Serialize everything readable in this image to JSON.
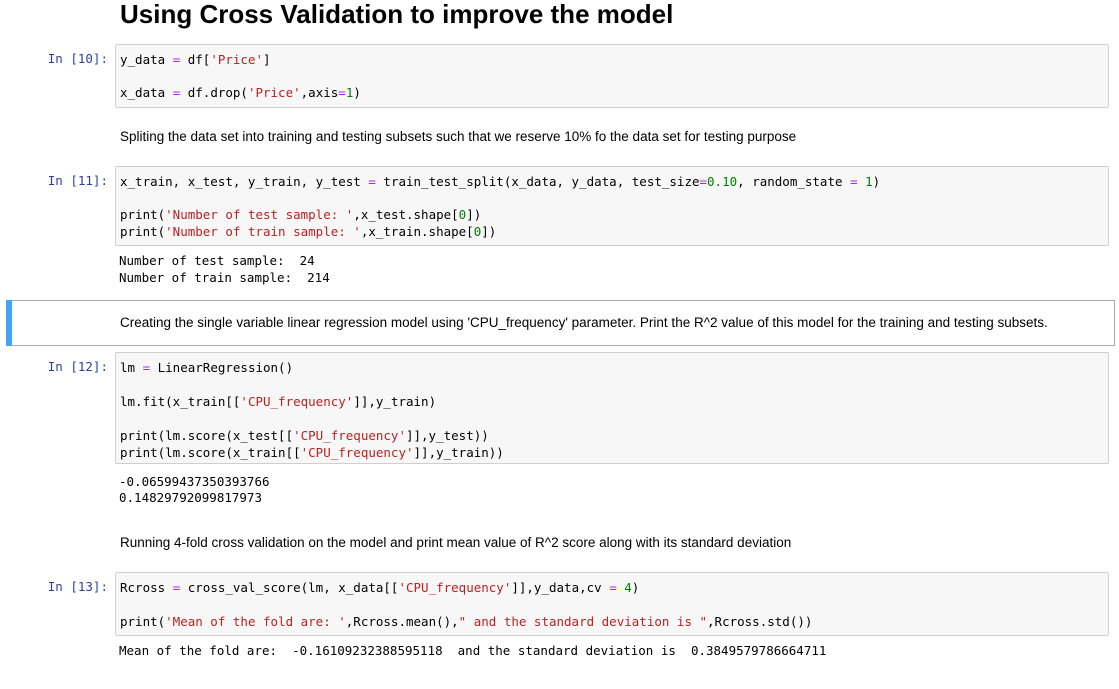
{
  "heading": "Using Cross Validation to improve the model",
  "cells": {
    "c10": {
      "prompt": "In [10]:",
      "lines": [
        {
          "a": "y_data ",
          "op": "=",
          "b": " df[",
          "s": "'Price'",
          "c": "]"
        },
        {
          "a": "x_data ",
          "op": "=",
          "b": " df.drop(",
          "s": "'Price'",
          "c": ",axis",
          "op2": "=",
          "n": "1",
          "d": ")"
        }
      ]
    },
    "md1": "Spliting the data set into training and testing subsets such that we reserve 10% fo the data set for testing purpose",
    "c11": {
      "prompt": "In [11]:",
      "l1a": "x_train, x_test, y_train, y_test ",
      "l1op": "=",
      "l1b": " train_test_split(x_data, y_data, test_size",
      "l1op2": "=",
      "l1n": "0.10",
      "l1c": ", random_state ",
      "l1op3": "=",
      "l1d": " ",
      "l1n2": "1",
      "l1e": ")",
      "l2a": "print(",
      "l2s": "'Number of test sample: '",
      "l2b": ",x_test.shape[",
      "l2n": "0",
      "l2c": "])",
      "l3a": "print(",
      "l3s": "'Number of train sample: '",
      "l3b": ",x_train.shape[",
      "l3n": "0",
      "l3c": "])",
      "out1": "Number of test sample:  24",
      "out2": "Number of train sample:  214"
    },
    "md2": "Creating the single variable linear regression model using 'CPU_frequency' parameter. Print the R^2 value of this model for the training and testing subsets.",
    "c12": {
      "prompt": "In [12]:",
      "l1a": "lm ",
      "l1op": "=",
      "l1b": " LinearRegression()",
      "l2a": "lm.fit(x_train[[",
      "l2s": "'CPU_frequency'",
      "l2b": "]],y_train)",
      "l3a": "print(lm.score(x_test[[",
      "l3s": "'CPU_frequency'",
      "l3b": "]],y_test))",
      "l4a": "print(lm.score(x_train[[",
      "l4s": "'CPU_frequency'",
      "l4b": "]],y_train))",
      "out1": "-0.06599437350393766",
      "out2": "0.14829792099817973"
    },
    "md3": "Running 4-fold cross validation on the model and print mean value of R^2 score along with its standard deviation",
    "c13": {
      "prompt": "In [13]:",
      "l1a": "Rcross ",
      "l1op": "=",
      "l1b": " cross_val_score(lm, x_data[[",
      "l1s": "'CPU_frequency'",
      "l1c": "]],y_data,cv ",
      "l1op2": "=",
      "l1d": " ",
      "l1n": "4",
      "l1e": ")",
      "l2a": "print(",
      "l2s": "'Mean of the fold are: '",
      "l2b": ",Rcross.mean(),",
      "l2s2": "\" and the standard deviation is \"",
      "l2c": ",Rcross.std())",
      "out1": "Mean of the fold are:  -0.16109232388595118  and the standard deviation is  0.3849579786664711"
    }
  },
  "colors": {
    "prompt": "#303f9f",
    "string": "#ba2121",
    "number": "#008000",
    "operator": "#aa22ff",
    "selected_bar": "#42a5f5"
  }
}
